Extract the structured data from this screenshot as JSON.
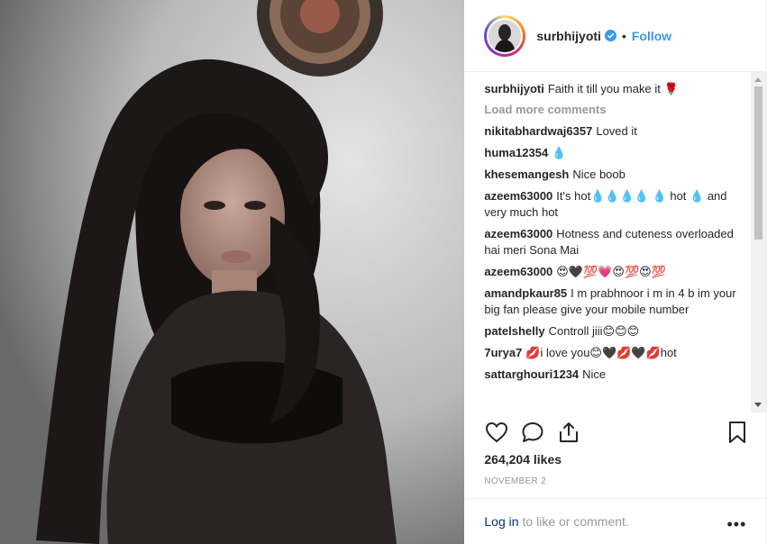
{
  "post": {
    "username": "surbhijyoti",
    "follow_label": "Follow",
    "caption": "Faith it till you make it 🌹",
    "load_more": "Load more comments",
    "comments": [
      {
        "user": "nikitabhardwaj6357",
        "text": "Loved it"
      },
      {
        "user": "huma12354",
        "text": "💧"
      },
      {
        "user": "khesemangesh",
        "text": "Nice boob"
      },
      {
        "user": "azeem63000",
        "text": "It's hot💧💧💧💧 💧 hot 💧 and very much hot"
      },
      {
        "user": "azeem63000",
        "text": "Hotness and cuteness overloaded hai meri Sona Mai"
      },
      {
        "user": "azeem63000",
        "text": "😍🖤💯💗😍💯😍💯"
      },
      {
        "user": "amandpkaur85",
        "text": "I m prabhnoor i m in 4 b im your big fan please give your mobile number"
      },
      {
        "user": "patelshelly",
        "text": "Controll jiii😊😊😊"
      },
      {
        "user": "7urya7",
        "text": "💋i love you😊🖤💋🖤💋hot"
      },
      {
        "user": "sattarghouri1234",
        "text": "Nice"
      }
    ],
    "likes": "264,204 likes",
    "date": "NOVEMBER 2",
    "login_label": "Log in",
    "login_suffix": "to like or comment.",
    "more_icon": "•••"
  },
  "icons": {
    "like": "heart-icon",
    "comment": "comment-icon",
    "share": "share-icon",
    "save": "bookmark-icon",
    "verified": "verified-badge-icon"
  },
  "colors": {
    "accent": "#3897f0",
    "muted": "#999999",
    "link": "#003569"
  }
}
